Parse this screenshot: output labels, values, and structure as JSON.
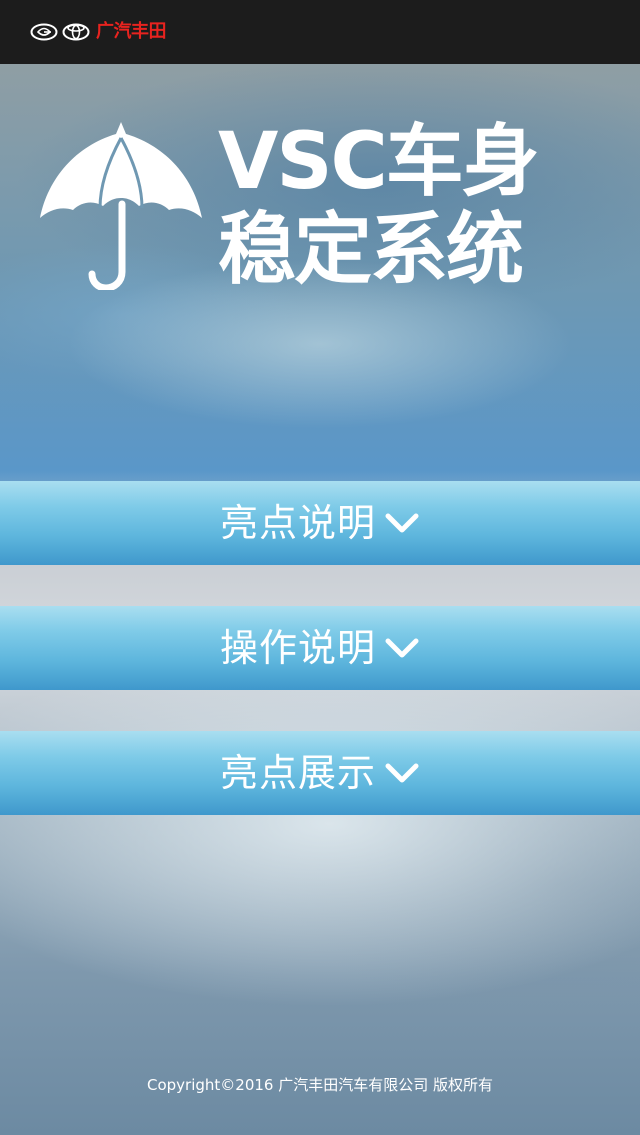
{
  "header": {
    "brand_name": "广汽丰田",
    "brand_color": "#e8231f",
    "icons": [
      "gac-logo-icon",
      "toyota-logo-icon"
    ]
  },
  "hero": {
    "title_line1": "VSC车身",
    "title_line2": "稳定系统",
    "icon": "umbrella-icon"
  },
  "menu": {
    "items": [
      {
        "label": "亮点说明",
        "icon": "chevron-down-icon"
      },
      {
        "label": "操作说明",
        "icon": "chevron-down-icon"
      },
      {
        "label": "亮点展示",
        "icon": "chevron-down-icon"
      }
    ]
  },
  "footer": {
    "copyright": "Copyright©2016 广汽丰田汽车有限公司 版权所有"
  }
}
